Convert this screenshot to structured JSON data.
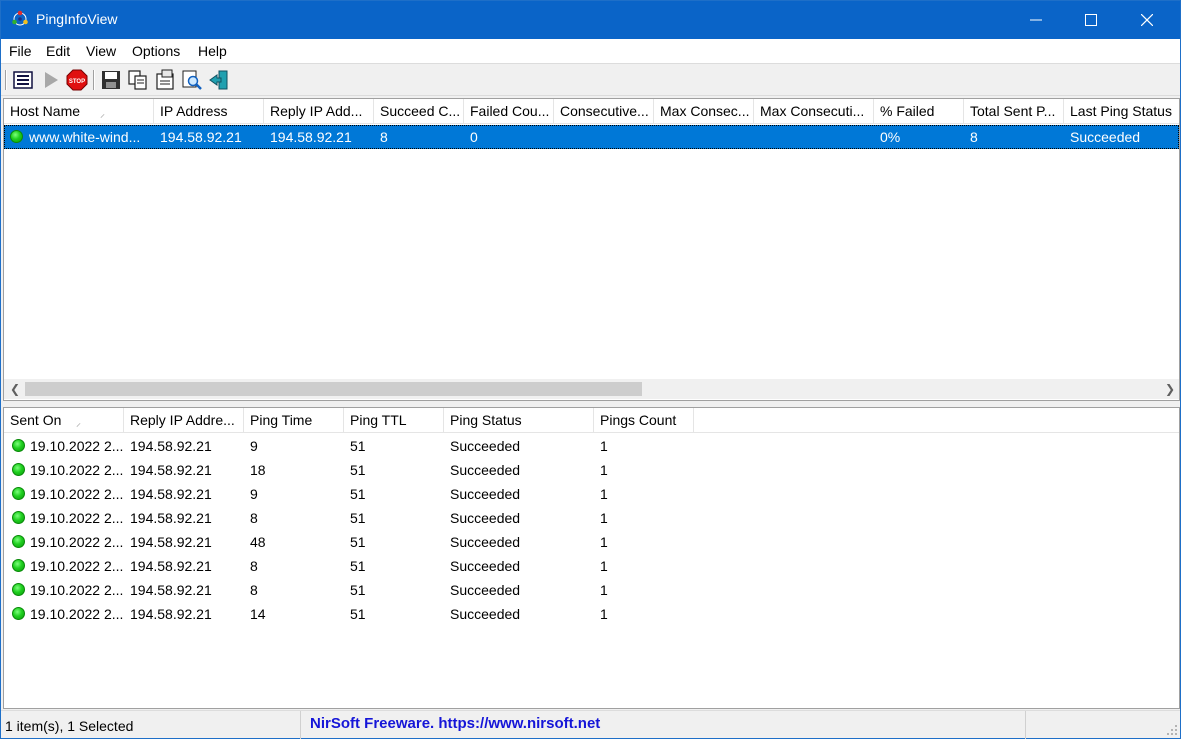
{
  "window": {
    "title": "PingInfoView"
  },
  "menu": [
    "File",
    "Edit",
    "View",
    "Options",
    "Help"
  ],
  "toolbar": {
    "buttons": [
      "properties-icon",
      "start-icon",
      "stop-icon",
      "save-icon",
      "copy-icon",
      "html-report-icon",
      "find-icon",
      "exit-icon"
    ]
  },
  "top_list": {
    "columns": [
      "Host Name",
      "IP Address",
      "Reply IP Add...",
      "Succeed C...",
      "Failed Cou...",
      "Consecutive...",
      "Max Consec...",
      "Max Consecuti...",
      "% Failed",
      "Total Sent P...",
      "Last Ping Status"
    ],
    "rows": [
      {
        "host": "www.white-wind...",
        "ip": "194.58.92.21",
        "reply_ip": "194.58.92.21",
        "succeed": "8",
        "failed": "0",
        "consecutive": "",
        "max_consec": "",
        "max_consecutive": "",
        "pct_failed": "0%",
        "total_sent": "8",
        "last_status": "Succeeded",
        "selected": true
      }
    ]
  },
  "bottom_list": {
    "columns": [
      "Sent On",
      "Reply IP Addre...",
      "Ping Time",
      "Ping TTL",
      "Ping Status",
      "Pings Count"
    ],
    "rows": [
      {
        "sent_on": "19.10.2022 2...",
        "reply_ip": "194.58.92.21",
        "ping_time": "9",
        "ttl": "51",
        "status": "Succeeded",
        "count": "1"
      },
      {
        "sent_on": "19.10.2022 2...",
        "reply_ip": "194.58.92.21",
        "ping_time": "18",
        "ttl": "51",
        "status": "Succeeded",
        "count": "1"
      },
      {
        "sent_on": "19.10.2022 2...",
        "reply_ip": "194.58.92.21",
        "ping_time": "9",
        "ttl": "51",
        "status": "Succeeded",
        "count": "1"
      },
      {
        "sent_on": "19.10.2022 2...",
        "reply_ip": "194.58.92.21",
        "ping_time": "8",
        "ttl": "51",
        "status": "Succeeded",
        "count": "1"
      },
      {
        "sent_on": "19.10.2022 2...",
        "reply_ip": "194.58.92.21",
        "ping_time": "48",
        "ttl": "51",
        "status": "Succeeded",
        "count": "1"
      },
      {
        "sent_on": "19.10.2022 2...",
        "reply_ip": "194.58.92.21",
        "ping_time": "8",
        "ttl": "51",
        "status": "Succeeded",
        "count": "1"
      },
      {
        "sent_on": "19.10.2022 2...",
        "reply_ip": "194.58.92.21",
        "ping_time": "8",
        "ttl": "51",
        "status": "Succeeded",
        "count": "1"
      },
      {
        "sent_on": "19.10.2022 2...",
        "reply_ip": "194.58.92.21",
        "ping_time": "14",
        "ttl": "51",
        "status": "Succeeded",
        "count": "1"
      }
    ]
  },
  "status": {
    "selection": "1 item(s), 1 Selected",
    "link": "NirSoft Freeware. https://www.nirsoft.net"
  },
  "colors": {
    "titlebar": "#0a64c8",
    "selection": "#0078d7",
    "link": "#1515d8",
    "status_ok": "#20d020"
  }
}
